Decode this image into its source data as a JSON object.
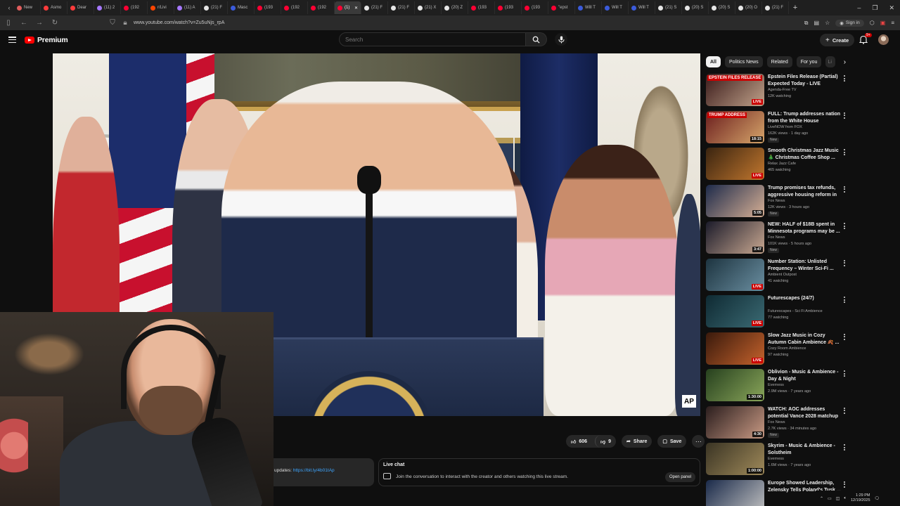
{
  "browser": {
    "tabs": [
      {
        "label": "New",
        "color": "#e05d5d"
      },
      {
        "label": "Asmo",
        "color": "#ff3b3b"
      },
      {
        "label": "Dear",
        "color": "#ff3b3b"
      },
      {
        "label": "(11) 2",
        "color": "#a678ff"
      },
      {
        "label": "(192",
        "color": "#ff0033"
      },
      {
        "label": "r/Livi",
        "color": "#ff4500"
      },
      {
        "label": "(11) A",
        "color": "#a678ff"
      },
      {
        "label": "(21) F",
        "color": "#e6e6e6"
      },
      {
        "label": "Masc",
        "color": "#3b5bdb"
      },
      {
        "label": "(193",
        "color": "#ff0033"
      },
      {
        "label": "(192",
        "color": "#ff0033"
      },
      {
        "label": "(192",
        "color": "#ff0033"
      },
      {
        "label": "(1)",
        "color": "#ff0033",
        "active": true
      },
      {
        "label": "(21) F",
        "color": "#e6e6e6"
      },
      {
        "label": "(21) F",
        "color": "#e6e6e6"
      },
      {
        "label": "(21) X",
        "color": "#e6e6e6"
      },
      {
        "label": "(20) Z",
        "color": "#e6e6e6"
      },
      {
        "label": "(193",
        "color": "#ff0033"
      },
      {
        "label": "(193",
        "color": "#ff0033"
      },
      {
        "label": "(193",
        "color": "#ff0033"
      },
      {
        "label": "\"epst",
        "color": "#ff0033"
      },
      {
        "label": "Will T",
        "color": "#3b5bdb"
      },
      {
        "label": "Will T",
        "color": "#3b5bdb"
      },
      {
        "label": "Will T",
        "color": "#3b5bdb"
      },
      {
        "label": "(21) S",
        "color": "#e6e6e6"
      },
      {
        "label": "(20) S",
        "color": "#e6e6e6"
      },
      {
        "label": "(20) S",
        "color": "#e6e6e6"
      },
      {
        "label": "(20) O",
        "color": "#e6e6e6"
      },
      {
        "label": "(21) F",
        "color": "#e6e6e6"
      }
    ],
    "url": "www.youtube.com/watch?v=Zu5uNjs_rpA",
    "signin_label": "Sign in"
  },
  "header": {
    "brand": "Premium",
    "search_placeholder": "Search",
    "create_label": "Create",
    "notification_count": "9+"
  },
  "video": {
    "watermark": "AP",
    "likes": "606",
    "dislikes": "9",
    "share_label": "Share",
    "save_label": "Save"
  },
  "description": {
    "prefix": "updates: ",
    "link": "https://bit.ly/4b01tAp"
  },
  "live_chat": {
    "title": "Live chat",
    "message": "Join the conversation to interact with the creator and others watching this live stream.",
    "open_panel_label": "Open panel"
  },
  "chips": [
    {
      "label": "All",
      "active": true
    },
    {
      "label": "Politics News"
    },
    {
      "label": "Related"
    },
    {
      "label": "For you"
    },
    {
      "label": "Li",
      "faded": true
    }
  ],
  "recommendations": [
    {
      "title": "Epstein Files Release (Partial) Expected Today - LIVE Breakin...",
      "channel": "Agenda-Free TV",
      "meta": "12K watching",
      "badge": "LIVE",
      "thumb_text": "EPSTEIN FILES RELEASE",
      "thumb_colors": [
        "#3a1a1a",
        "#c0a28a"
      ]
    },
    {
      "title": "FULL: Trump addresses nation from the White House",
      "channel": "LiveNOW from FOX",
      "meta": "162K views · 1 day ago",
      "badge": "18:15",
      "is_new": true,
      "thumb_text": "TRUMP ADDRESS",
      "thumb_colors": [
        "#6b1e1e",
        "#d6a56a"
      ]
    },
    {
      "title": "Smooth Christmas Jazz Music 🎄 Christmas Coffee Shop ...",
      "channel": "Relax Jazz Cafe",
      "meta": "465 watching",
      "badge": "LIVE",
      "thumb_text": "",
      "thumb_colors": [
        "#3a2410",
        "#c2772e"
      ]
    },
    {
      "title": "Trump promises tax refunds, aggressive housing reform in ...",
      "channel": "Fox News",
      "meta": "12K views · 3 hours ago",
      "badge": "5:05",
      "is_new": true,
      "thumb_text": "",
      "thumb_colors": [
        "#1d2a4a",
        "#d7b095"
      ]
    },
    {
      "title": "NEW: HALF of $18B spent in Minnesota programs may be ...",
      "channel": "Fox News",
      "meta": "101K views · 5 hours ago",
      "badge": "3:47",
      "is_new": true,
      "thumb_text": "",
      "thumb_colors": [
        "#1b1b2a",
        "#c9a891"
      ]
    },
    {
      "title": "Number Station: Unlisted Frequency – Winter Sci-Fi ...",
      "channel": "Ambient Outpost",
      "meta": "41 watching",
      "badge": "LIVE",
      "thumb_text": "",
      "thumb_colors": [
        "#1d3440",
        "#6a8ea0"
      ]
    },
    {
      "title": "Futurescapes (24/7)",
      "channel": "Futurescapes - Sci Fi Ambience",
      "meta": "77 watching",
      "badge": "LIVE",
      "thumb_text": "",
      "thumb_colors": [
        "#0f2a33",
        "#3b6a73"
      ]
    },
    {
      "title": "Slow Jazz Music in Cozy Autumn Cabin Ambience 🍂 ...",
      "channel": "Cozy Room Ambience",
      "meta": "97 watching",
      "badge": "LIVE",
      "thumb_text": "",
      "thumb_colors": [
        "#3a1a0c",
        "#c4622c"
      ]
    },
    {
      "title": "Oblivion - Music & Ambience - Day & Night",
      "channel": "Everness",
      "meta": "2.9M views · 7 years ago",
      "badge": "1:30:00",
      "thumb_text": "",
      "thumb_colors": [
        "#26401e",
        "#8aa65a"
      ]
    },
    {
      "title": "WATCH: AOC addresses potential Vance 2028 matchup",
      "channel": "Fox News",
      "meta": "2.7K views · 34 minutes ago",
      "badge": "4:30",
      "is_new": true,
      "thumb_text": "",
      "thumb_colors": [
        "#2a1d1d",
        "#c99a84"
      ]
    },
    {
      "title": "Skyrim - Music & Ambience - Solstheim",
      "channel": "Everness",
      "meta": "1.6M views · 7 years ago",
      "badge": "1:00:00",
      "thumb_text": "",
      "thumb_colors": [
        "#3a3424",
        "#a08a5a"
      ]
    },
    {
      "title": "Europe Showed Leadership, Zelensky Tells Poland's Tusk ...",
      "channel": "",
      "meta": "",
      "badge": "",
      "thumb_text": "",
      "thumb_colors": [
        "#1a2a4a",
        "#c0c0c0"
      ]
    }
  ],
  "taskbar": {
    "time": "1:29 PM",
    "date": "12/19/2025"
  }
}
